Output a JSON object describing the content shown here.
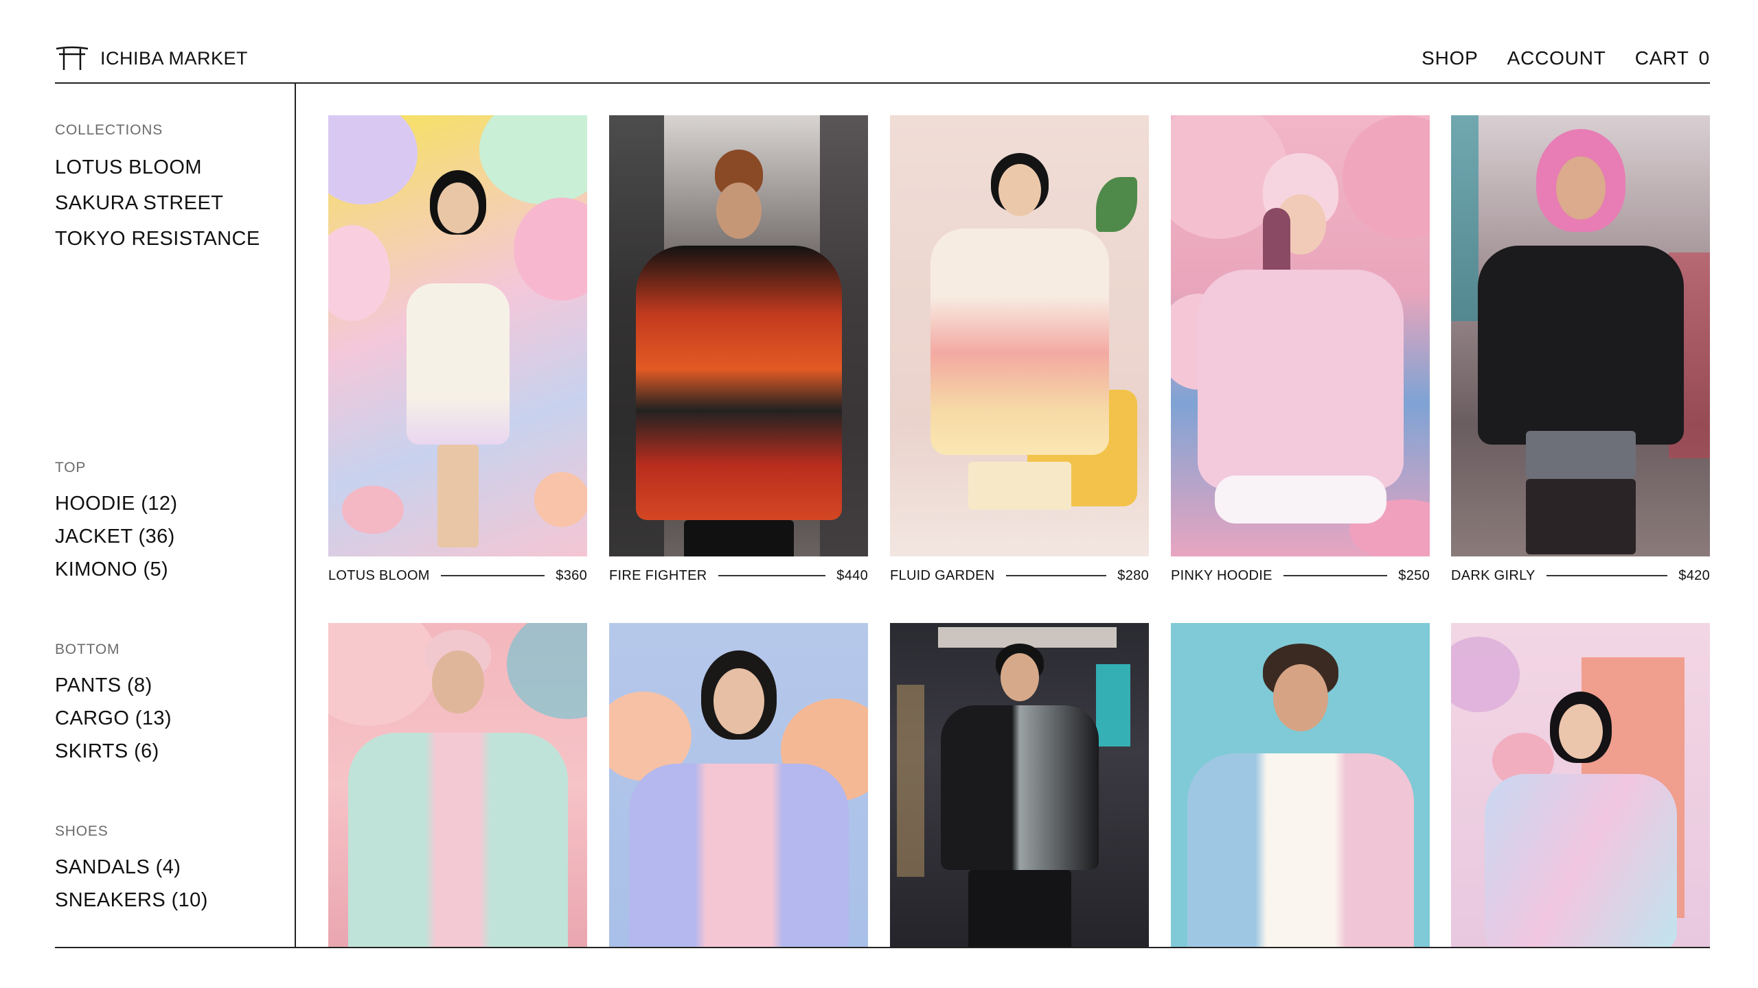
{
  "header": {
    "brand": "ICHIBA MARKET",
    "brand_icon": "torii-gate-icon",
    "nav": {
      "shop": "SHOP",
      "account": "ACCOUNT",
      "cart": "CART",
      "cart_count": "0"
    }
  },
  "sidebar": {
    "collections": {
      "heading": "COLLECTIONS",
      "items": [
        "LOTUS BLOOM",
        "SAKURA STREET",
        "TOKYO RESISTANCE"
      ]
    },
    "top": {
      "heading": "TOP",
      "items": [
        "HOODIE (12)",
        "JACKET (36)",
        "KIMONO (5)"
      ]
    },
    "bottom": {
      "heading": "BOTTOM",
      "items": [
        "PANTS (8)",
        "CARGO (13)",
        "SKIRTS (6)"
      ]
    },
    "shoes": {
      "heading": "SHOES",
      "items": [
        "SANDALS (4)",
        "SNEAKERS (10)"
      ]
    }
  },
  "products": [
    {
      "name": "LOTUS BLOOM",
      "price": "$360"
    },
    {
      "name": "FIRE FIGHTER",
      "price": "$440"
    },
    {
      "name": "FLUID GARDEN",
      "price": "$280"
    },
    {
      "name": "PINKY HOODIE",
      "price": "$250"
    },
    {
      "name": "DARK GIRLY",
      "price": "$420"
    }
  ],
  "colors": {
    "text": "#111111",
    "muted": "#6b6b6b",
    "rule": "#222222"
  }
}
